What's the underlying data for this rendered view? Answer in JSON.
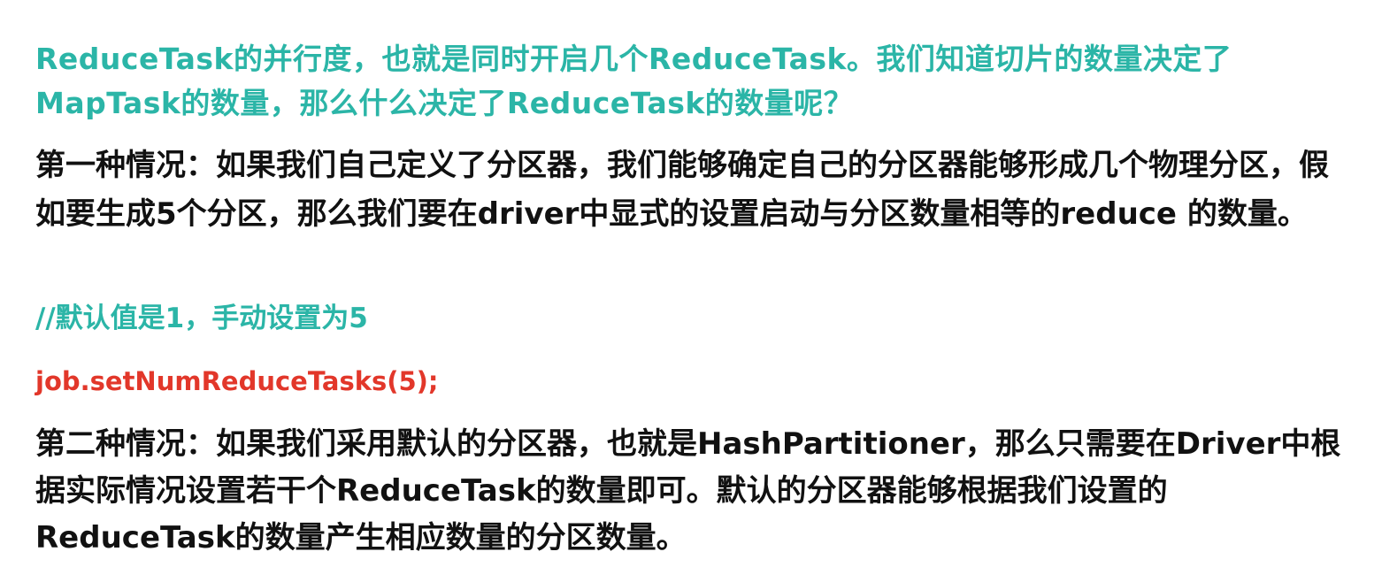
{
  "slide": {
    "question": "ReduceTask的并行度，也就是同时开启几个ReduceTask。我们知道切片的数量决定了MapTask的数量，那么什么决定了ReduceTask的数量呢？",
    "case1": "第一种情况：如果我们自己定义了分区器，我们能够确定自己的分区器能够形成几个物理分区，假如要生成5个分区，那么我们要在driver中显式的设置启动与分区数量相等的reduce  的数量。",
    "comment": "//默认值是1，手动设置为5",
    "code": "job.setNumReduceTasks(5);",
    "case2": "第二种情况：如果我们采用默认的分区器，也就是HashPartitioner，那么只需要在Driver中根据实际情况设置若干个ReduceTask的数量即可。默认的分区器能够根据我们设置的ReduceTask的数量产生相应数量的分区数量。"
  },
  "colors": {
    "teal": "#2bb5a7",
    "text": "#111111",
    "code_red": "#e2372a",
    "background": "#ffffff"
  }
}
